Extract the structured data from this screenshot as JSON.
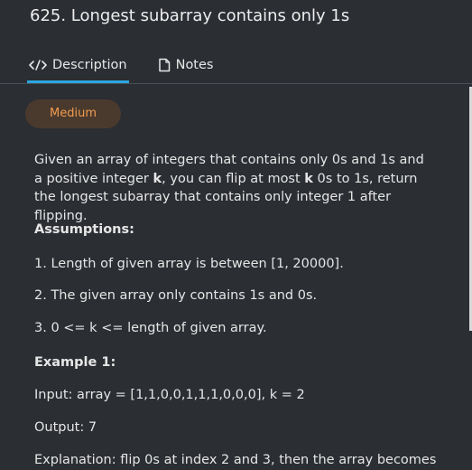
{
  "header": {
    "title": "625. Longest subarray contains only 1s",
    "tabs": [
      {
        "label": "Description",
        "icon": "code-icon"
      },
      {
        "label": "Notes",
        "icon": "note-icon"
      }
    ]
  },
  "problem": {
    "difficulty": "Medium",
    "intro_1": "Given an array of integers that contains only 0s and 1s and a positive integer ",
    "intro_k1": "k",
    "intro_2": ", you can flip at most ",
    "intro_k2": "k",
    "intro_3": " 0s to 1s, return the longest subarray that contains only integer 1 after flipping.",
    "assumptions_heading": "Assumptions:",
    "assumptions": [
      "1. Length of given array is between [1, 20000].",
      "2. The given array only contains 1s and 0s.",
      "3. 0 <= k <= length of given array."
    ],
    "example_heading": "Example 1:",
    "example_input": "Input: array = [1,1,0,0,1,1,1,0,0,0], k = 2",
    "example_output": "Output: 7",
    "example_explanation": "Explanation: flip 0s at index 2 and 3, then the array becomes"
  },
  "colors": {
    "background": "#2b2e33",
    "accent": "#2aa7e0",
    "badge_bg": "#4a3a2e",
    "badge_text": "#f29b4f"
  }
}
